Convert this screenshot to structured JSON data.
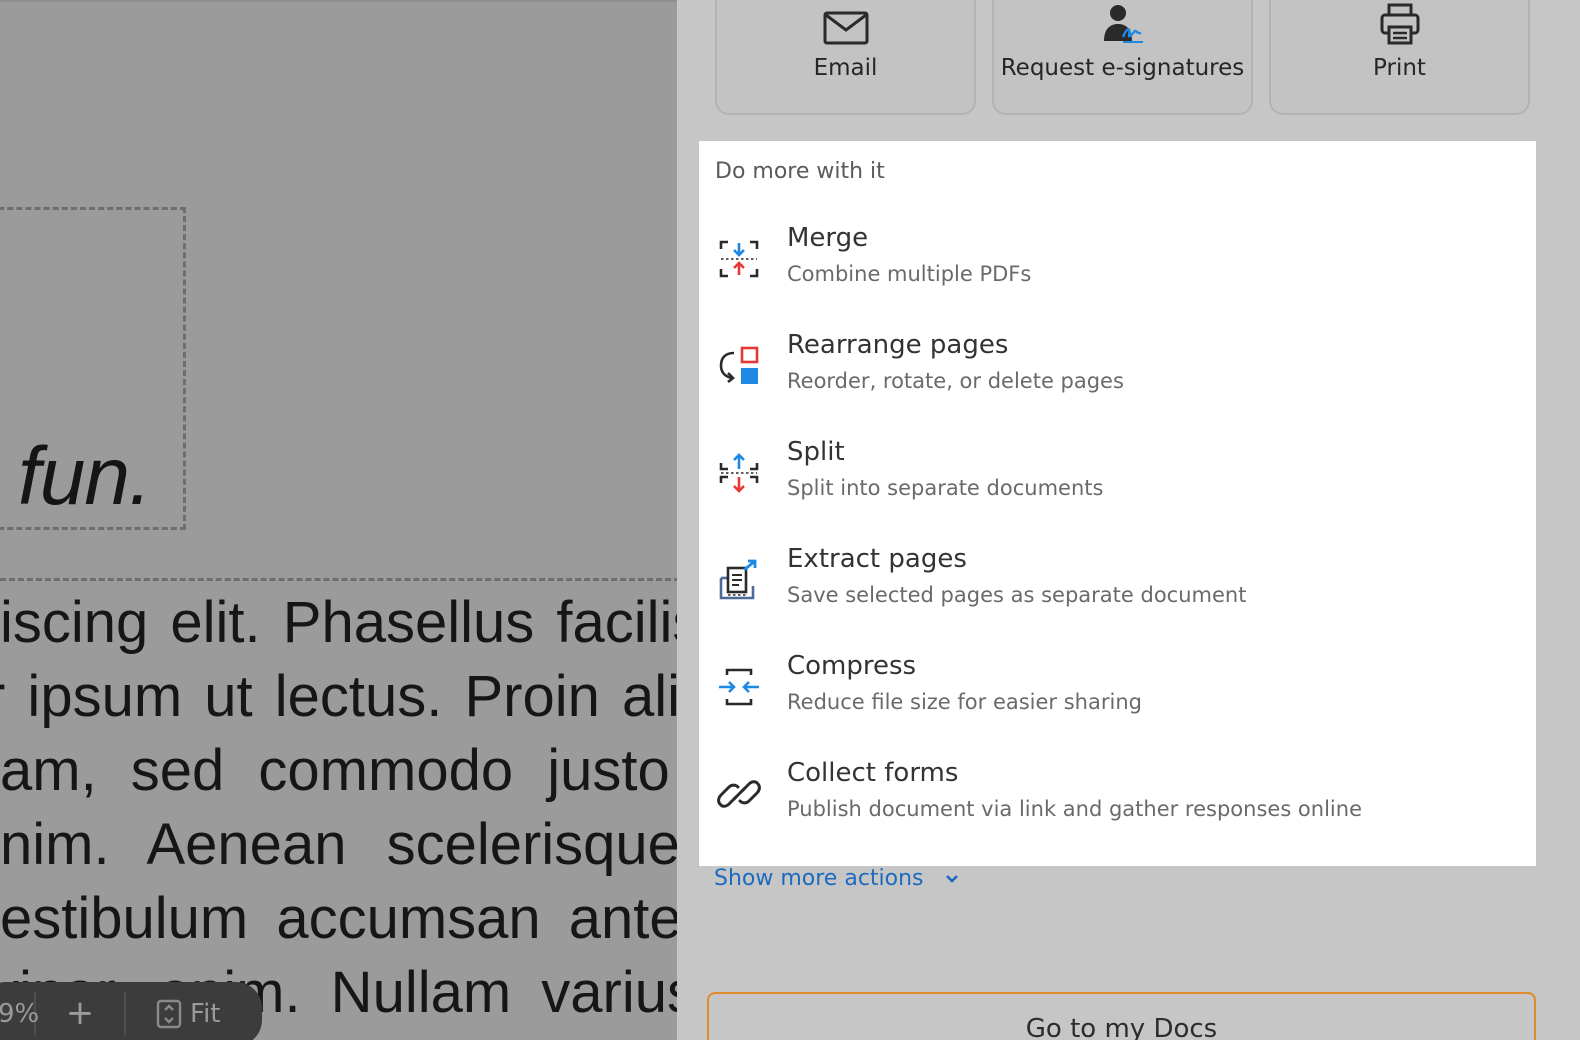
{
  "document": {
    "heading_fragment": "fun.",
    "body_lines": [
      "iscing elit. Phasellus facilis",
      "r ipsum ut lectus. Proin alic",
      "am, sed commodo justo",
      "nim. Aenean scelerisque",
      "estibulum accumsan ante",
      "vinar, enim. Nullam varius"
    ]
  },
  "zoom_bar": {
    "zoom_value": "9%",
    "zoom_in_label": "+",
    "fit_label": "Fit"
  },
  "share_actions": [
    {
      "label": "Email",
      "icon": "envelope-icon"
    },
    {
      "label": "Request e-signatures",
      "icon": "signature-icon"
    },
    {
      "label": "Print",
      "icon": "printer-icon"
    }
  ],
  "more_section": {
    "heading": "Do more with it",
    "actions": [
      {
        "title": "Merge",
        "description": "Combine multiple PDFs",
        "icon": "merge-icon"
      },
      {
        "title": "Rearrange pages",
        "description": "Reorder, rotate, or delete pages",
        "icon": "rearrange-icon"
      },
      {
        "title": "Split",
        "description": "Split into separate documents",
        "icon": "split-icon"
      },
      {
        "title": "Extract pages",
        "description": "Save selected pages as separate document",
        "icon": "extract-icon"
      },
      {
        "title": "Compress",
        "description": "Reduce file size for easier sharing",
        "icon": "compress-icon"
      },
      {
        "title": "Collect forms",
        "description": "Publish document via link and gather responses online",
        "icon": "link-icon"
      }
    ],
    "show_more_label": "Show more actions"
  },
  "go_to_docs_label": "Go to my Docs",
  "colors": {
    "accent_blue": "#1e88e5",
    "accent_red": "#e53935",
    "link_blue": "#1e6ac0",
    "cta_border": "#e08a2a"
  }
}
